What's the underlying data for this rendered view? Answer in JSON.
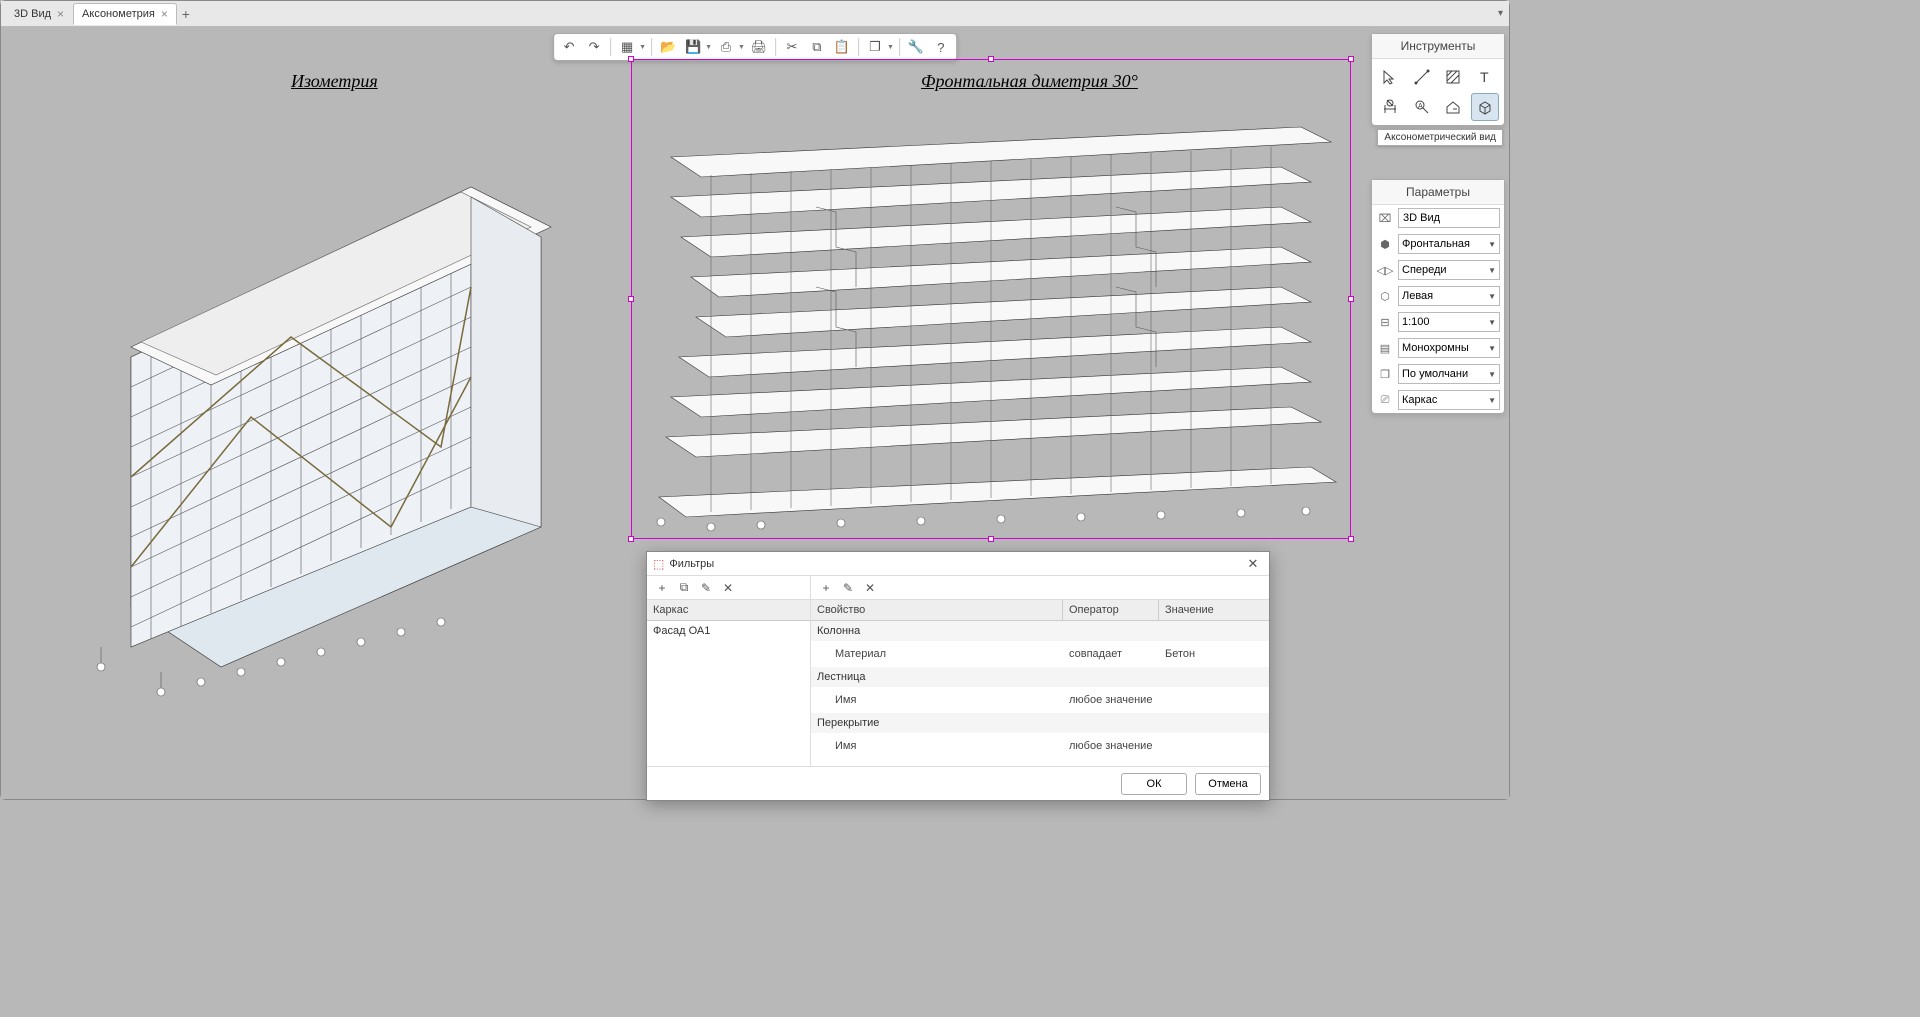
{
  "tabs": {
    "items": [
      {
        "label": "3D Вид"
      },
      {
        "label": "Аксонометрия"
      }
    ],
    "active_index": 1
  },
  "view_labels": {
    "left": "Изометрия",
    "right": "Фронтальная диметрия 30°"
  },
  "tools_panel": {
    "title": "Инструменты",
    "tooltip_active": "Аксонометрический вид"
  },
  "params_panel": {
    "title": "Параметры",
    "view_name": "3D Вид",
    "projection": "Фронтальная",
    "direction": "Спереди",
    "side": "Левая",
    "scale": "1:100",
    "style": "Монохромны",
    "mode": "По умолчани",
    "display": "Каркас"
  },
  "dialog": {
    "title": "Фильтры",
    "list_header": "Каркас",
    "list_items": [
      "Фасад ОА1"
    ],
    "columns": {
      "property": "Свойство",
      "operator": "Оператор",
      "value": "Значение"
    },
    "groups": [
      {
        "name": "Колонна",
        "rows": [
          {
            "property": "Материал",
            "operator": "совпадает",
            "value": "Бетон"
          }
        ]
      },
      {
        "name": "Лестница",
        "rows": [
          {
            "property": "Имя",
            "operator": "любое значение",
            "value": ""
          }
        ]
      },
      {
        "name": "Перекрытие",
        "rows": [
          {
            "property": "Имя",
            "operator": "любое значение",
            "value": ""
          }
        ]
      }
    ],
    "ok": "ОК",
    "cancel": "Отмена"
  }
}
